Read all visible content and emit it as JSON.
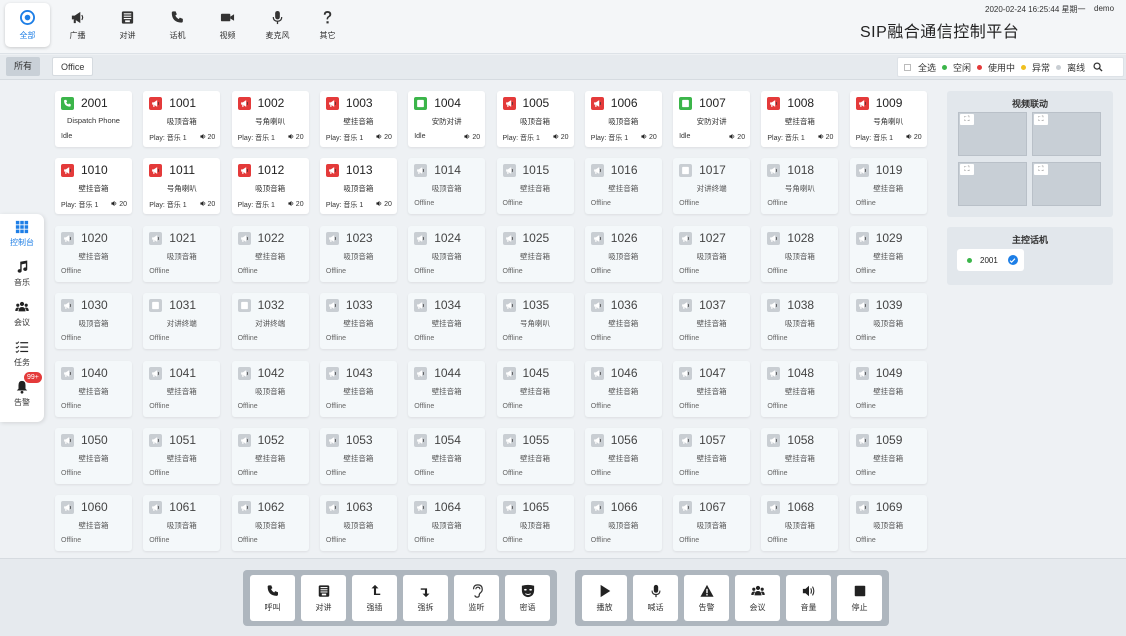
{
  "topnav": [
    {
      "label": "全部",
      "icon": "target-icon",
      "active": true
    },
    {
      "label": "广播",
      "icon": "megaphone-icon"
    },
    {
      "label": "对讲",
      "icon": "intercom-icon"
    },
    {
      "label": "话机",
      "icon": "phone-icon"
    },
    {
      "label": "视频",
      "icon": "video-camera-icon"
    },
    {
      "label": "麦克风",
      "icon": "microphone-icon"
    },
    {
      "label": "其它",
      "icon": "question-icon"
    }
  ],
  "header": {
    "datetime": "2020-02-24 16:25:44 星期一",
    "user": "demo",
    "title": "SIP融合通信控制平台"
  },
  "filter": {
    "tabs": [
      "所有",
      "Office"
    ],
    "select_all": "全选",
    "legend": [
      {
        "label": "空闲",
        "color": "#3bb54a"
      },
      {
        "label": "使用中",
        "color": "#e43a3a"
      },
      {
        "label": "异常",
        "color": "#f0c020"
      },
      {
        "label": "离线",
        "color": "#c9ced3"
      }
    ]
  },
  "sidebar": [
    {
      "label": "控制台",
      "icon": "grid-icon",
      "active": true
    },
    {
      "label": "音乐",
      "icon": "music-note-icon"
    },
    {
      "label": "会议",
      "icon": "people-icon"
    },
    {
      "label": "任务",
      "icon": "checklist-icon"
    },
    {
      "label": "告警",
      "icon": "bell-icon",
      "badge": "99+"
    }
  ],
  "colors": {
    "green": "#3bb54a",
    "red": "#e43a3a",
    "grey": "#c9ced3"
  },
  "devices": [
    {
      "num": "2001",
      "name": "Dispatch Phone",
      "status": "Idle",
      "color": "green",
      "icon": "phone-icon"
    },
    {
      "num": "1001",
      "name": "吸顶音箱",
      "status": "Play: 音乐 1",
      "vol": "20",
      "color": "red",
      "icon": "megaphone-icon"
    },
    {
      "num": "1002",
      "name": "号角喇叭",
      "status": "Play: 音乐 1",
      "vol": "20",
      "color": "red",
      "icon": "megaphone-icon"
    },
    {
      "num": "1003",
      "name": "壁挂音箱",
      "status": "Play: 音乐 1",
      "vol": "20",
      "color": "red",
      "icon": "megaphone-icon"
    },
    {
      "num": "1004",
      "name": "安防对讲",
      "status": "Idle",
      "vol": "20",
      "color": "green",
      "icon": "intercom-icon"
    },
    {
      "num": "1005",
      "name": "吸顶音箱",
      "status": "Play: 音乐 1",
      "vol": "20",
      "color": "red",
      "icon": "megaphone-icon"
    },
    {
      "num": "1006",
      "name": "吸顶音箱",
      "status": "Play: 音乐 1",
      "vol": "20",
      "color": "red",
      "icon": "megaphone-icon"
    },
    {
      "num": "1007",
      "name": "安防对讲",
      "status": "Idle",
      "vol": "20",
      "color": "green",
      "icon": "intercom-icon"
    },
    {
      "num": "1008",
      "name": "壁挂音箱",
      "status": "Play: 音乐 1",
      "vol": "20",
      "color": "red",
      "icon": "megaphone-icon"
    },
    {
      "num": "1009",
      "name": "号角喇叭",
      "status": "Play: 音乐 1",
      "vol": "20",
      "color": "red",
      "icon": "megaphone-icon"
    },
    {
      "num": "1010",
      "name": "壁挂音箱",
      "status": "Play: 音乐 1",
      "vol": "20",
      "color": "red",
      "icon": "megaphone-icon"
    },
    {
      "num": "1011",
      "name": "号角喇叭",
      "status": "Play: 音乐 1",
      "vol": "20",
      "color": "red",
      "icon": "megaphone-icon"
    },
    {
      "num": "1012",
      "name": "吸顶音箱",
      "status": "Play: 音乐 1",
      "vol": "20",
      "color": "red",
      "icon": "megaphone-icon"
    },
    {
      "num": "1013",
      "name": "吸顶音箱",
      "status": "Play: 音乐 1",
      "vol": "20",
      "color": "red",
      "icon": "megaphone-icon"
    },
    {
      "num": "1014",
      "name": "吸顶音箱",
      "status": "Offline",
      "color": "grey",
      "icon": "megaphone-icon"
    },
    {
      "num": "1015",
      "name": "壁挂音箱",
      "status": "Offline",
      "color": "grey",
      "icon": "megaphone-icon"
    },
    {
      "num": "1016",
      "name": "壁挂音箱",
      "status": "Offline",
      "color": "grey",
      "icon": "megaphone-icon"
    },
    {
      "num": "1017",
      "name": "对讲终端",
      "status": "Offline",
      "color": "grey",
      "icon": "intercom-icon"
    },
    {
      "num": "1018",
      "name": "号角喇叭",
      "status": "Offline",
      "color": "grey",
      "icon": "megaphone-icon"
    },
    {
      "num": "1019",
      "name": "壁挂音箱",
      "status": "Offline",
      "color": "grey",
      "icon": "megaphone-icon"
    },
    {
      "num": "1020",
      "name": "壁挂音箱",
      "status": "Offline",
      "color": "grey",
      "icon": "megaphone-icon"
    },
    {
      "num": "1021",
      "name": "吸顶音箱",
      "status": "Offline",
      "color": "grey",
      "icon": "megaphone-icon"
    },
    {
      "num": "1022",
      "name": "壁挂音箱",
      "status": "Offline",
      "color": "grey",
      "icon": "megaphone-icon"
    },
    {
      "num": "1023",
      "name": "吸顶音箱",
      "status": "Offline",
      "color": "grey",
      "icon": "megaphone-icon"
    },
    {
      "num": "1024",
      "name": "吸顶音箱",
      "status": "Offline",
      "color": "grey",
      "icon": "megaphone-icon"
    },
    {
      "num": "1025",
      "name": "壁挂音箱",
      "status": "Offline",
      "color": "grey",
      "icon": "megaphone-icon"
    },
    {
      "num": "1026",
      "name": "吸顶音箱",
      "status": "Offline",
      "color": "grey",
      "icon": "megaphone-icon"
    },
    {
      "num": "1027",
      "name": "吸顶音箱",
      "status": "Offline",
      "color": "grey",
      "icon": "megaphone-icon"
    },
    {
      "num": "1028",
      "name": "吸顶音箱",
      "status": "Offline",
      "color": "grey",
      "icon": "megaphone-icon"
    },
    {
      "num": "1029",
      "name": "壁挂音箱",
      "status": "Offline",
      "color": "grey",
      "icon": "megaphone-icon"
    },
    {
      "num": "1030",
      "name": "吸顶音箱",
      "status": "Offline",
      "color": "grey",
      "icon": "megaphone-icon"
    },
    {
      "num": "1031",
      "name": "对讲终端",
      "status": "Offline",
      "color": "grey",
      "icon": "intercom-icon"
    },
    {
      "num": "1032",
      "name": "对讲终端",
      "status": "Offline",
      "color": "grey",
      "icon": "intercom-icon"
    },
    {
      "num": "1033",
      "name": "壁挂音箱",
      "status": "Offline",
      "color": "grey",
      "icon": "megaphone-icon"
    },
    {
      "num": "1034",
      "name": "壁挂音箱",
      "status": "Offline",
      "color": "grey",
      "icon": "megaphone-icon"
    },
    {
      "num": "1035",
      "name": "号角喇叭",
      "status": "Offline",
      "color": "grey",
      "icon": "megaphone-icon"
    },
    {
      "num": "1036",
      "name": "壁挂音箱",
      "status": "Offline",
      "color": "grey",
      "icon": "megaphone-icon"
    },
    {
      "num": "1037",
      "name": "壁挂音箱",
      "status": "Offline",
      "color": "grey",
      "icon": "megaphone-icon"
    },
    {
      "num": "1038",
      "name": "吸顶音箱",
      "status": "Offline",
      "color": "grey",
      "icon": "megaphone-icon"
    },
    {
      "num": "1039",
      "name": "吸顶音箱",
      "status": "Offline",
      "color": "grey",
      "icon": "megaphone-icon"
    },
    {
      "num": "1040",
      "name": "壁挂音箱",
      "status": "Offline",
      "color": "grey",
      "icon": "megaphone-icon"
    },
    {
      "num": "1041",
      "name": "壁挂音箱",
      "status": "Offline",
      "color": "grey",
      "icon": "megaphone-icon"
    },
    {
      "num": "1042",
      "name": "吸顶音箱",
      "status": "Offline",
      "color": "grey",
      "icon": "megaphone-icon"
    },
    {
      "num": "1043",
      "name": "壁挂音箱",
      "status": "Offline",
      "color": "grey",
      "icon": "megaphone-icon"
    },
    {
      "num": "1044",
      "name": "壁挂音箱",
      "status": "Offline",
      "color": "grey",
      "icon": "megaphone-icon"
    },
    {
      "num": "1045",
      "name": "壁挂音箱",
      "status": "Offline",
      "color": "grey",
      "icon": "megaphone-icon"
    },
    {
      "num": "1046",
      "name": "壁挂音箱",
      "status": "Offline",
      "color": "grey",
      "icon": "megaphone-icon"
    },
    {
      "num": "1047",
      "name": "壁挂音箱",
      "status": "Offline",
      "color": "grey",
      "icon": "megaphone-icon"
    },
    {
      "num": "1048",
      "name": "壁挂音箱",
      "status": "Offline",
      "color": "grey",
      "icon": "megaphone-icon"
    },
    {
      "num": "1049",
      "name": "壁挂音箱",
      "status": "Offline",
      "color": "grey",
      "icon": "megaphone-icon"
    },
    {
      "num": "1050",
      "name": "壁挂音箱",
      "status": "Offline",
      "color": "grey",
      "icon": "megaphone-icon"
    },
    {
      "num": "1051",
      "name": "壁挂音箱",
      "status": "Offline",
      "color": "grey",
      "icon": "megaphone-icon"
    },
    {
      "num": "1052",
      "name": "壁挂音箱",
      "status": "Offline",
      "color": "grey",
      "icon": "megaphone-icon"
    },
    {
      "num": "1053",
      "name": "壁挂音箱",
      "status": "Offline",
      "color": "grey",
      "icon": "megaphone-icon"
    },
    {
      "num": "1054",
      "name": "壁挂音箱",
      "status": "Offline",
      "color": "grey",
      "icon": "megaphone-icon"
    },
    {
      "num": "1055",
      "name": "壁挂音箱",
      "status": "Offline",
      "color": "grey",
      "icon": "megaphone-icon"
    },
    {
      "num": "1056",
      "name": "壁挂音箱",
      "status": "Offline",
      "color": "grey",
      "icon": "megaphone-icon"
    },
    {
      "num": "1057",
      "name": "壁挂音箱",
      "status": "Offline",
      "color": "grey",
      "icon": "megaphone-icon"
    },
    {
      "num": "1058",
      "name": "壁挂音箱",
      "status": "Offline",
      "color": "grey",
      "icon": "megaphone-icon"
    },
    {
      "num": "1059",
      "name": "壁挂音箱",
      "status": "Offline",
      "color": "grey",
      "icon": "megaphone-icon"
    },
    {
      "num": "1060",
      "name": "壁挂音箱",
      "status": "Offline",
      "color": "grey",
      "icon": "megaphone-icon"
    },
    {
      "num": "1061",
      "name": "吸顶音箱",
      "status": "Offline",
      "color": "grey",
      "icon": "megaphone-icon"
    },
    {
      "num": "1062",
      "name": "吸顶音箱",
      "status": "Offline",
      "color": "grey",
      "icon": "megaphone-icon"
    },
    {
      "num": "1063",
      "name": "吸顶音箱",
      "status": "Offline",
      "color": "grey",
      "icon": "megaphone-icon"
    },
    {
      "num": "1064",
      "name": "吸顶音箱",
      "status": "Offline",
      "color": "grey",
      "icon": "megaphone-icon"
    },
    {
      "num": "1065",
      "name": "吸顶音箱",
      "status": "Offline",
      "color": "grey",
      "icon": "megaphone-icon"
    },
    {
      "num": "1066",
      "name": "吸顶音箱",
      "status": "Offline",
      "color": "grey",
      "icon": "megaphone-icon"
    },
    {
      "num": "1067",
      "name": "吸顶音箱",
      "status": "Offline",
      "color": "grey",
      "icon": "megaphone-icon"
    },
    {
      "num": "1068",
      "name": "吸顶音箱",
      "status": "Offline",
      "color": "grey",
      "icon": "megaphone-icon"
    },
    {
      "num": "1069",
      "name": "吸顶音箱",
      "status": "Offline",
      "color": "grey",
      "icon": "megaphone-icon"
    }
  ],
  "video": {
    "title": "视频联动",
    "expand_glyph": "⛶"
  },
  "master": {
    "title": "主控话机",
    "phone": "2001"
  },
  "bottom_left": [
    {
      "label": "呼叫",
      "icon": "phone-icon"
    },
    {
      "label": "对讲",
      "icon": "intercom-icon"
    },
    {
      "label": "强插",
      "icon": "arrow-up-icon"
    },
    {
      "label": "强拆",
      "icon": "arrow-down-icon"
    },
    {
      "label": "监听",
      "icon": "ear-icon"
    },
    {
      "label": "密语",
      "icon": "mask-icon"
    }
  ],
  "bottom_right": [
    {
      "label": "播放",
      "icon": "play-icon"
    },
    {
      "label": "喊话",
      "icon": "microphone-icon"
    },
    {
      "label": "告警",
      "icon": "warning-icon"
    },
    {
      "label": "会议",
      "icon": "people-icon"
    },
    {
      "label": "音量",
      "icon": "volume-icon"
    },
    {
      "label": "停止",
      "icon": "stop-icon"
    }
  ]
}
